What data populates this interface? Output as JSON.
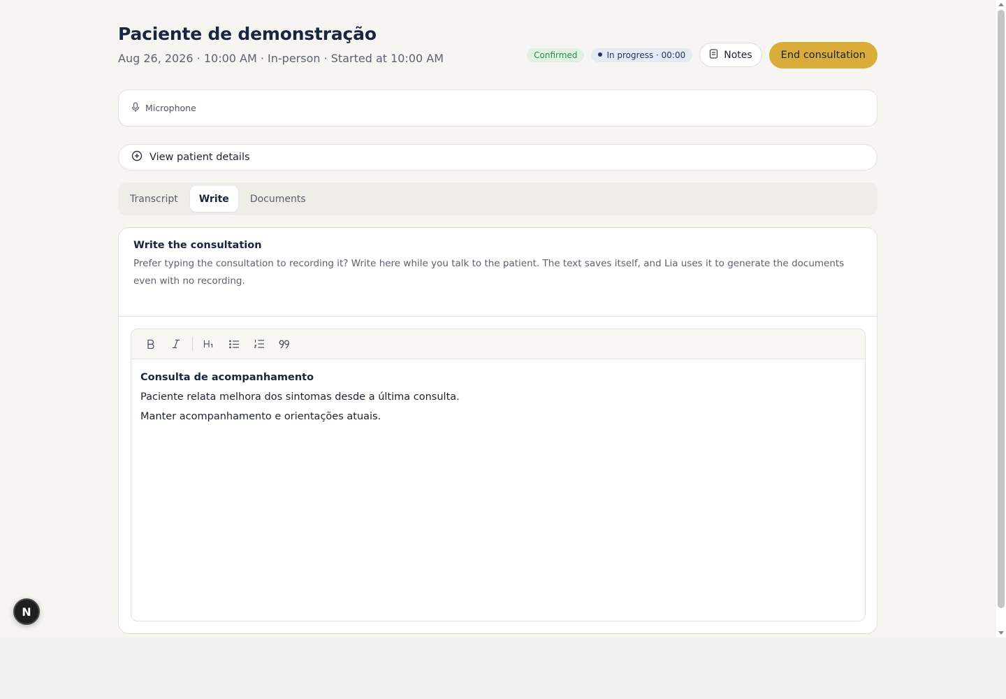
{
  "header": {
    "title": "Paciente de demonstração",
    "subtitle": "Aug 26, 2026 · 10:00 AM · In-person · Started at 10:00 AM",
    "status_badge": "Confirmed",
    "progress_badge": "In progress · 00:00",
    "notes_button": "Notes",
    "end_button": "End consultation",
    "colors": {
      "accent": "#d8ad3a",
      "confirmed": "#2e8a4b",
      "progress": "#253461"
    }
  },
  "microphone": {
    "label": "Microphone",
    "icon": "microphone-icon"
  },
  "patient_details": {
    "label": "View patient details",
    "icon": "heart-plus-icon"
  },
  "tabs": [
    {
      "label": "Transcript",
      "active": false
    },
    {
      "label": "Write",
      "active": true
    },
    {
      "label": "Documents",
      "active": false
    }
  ],
  "write": {
    "title": "Write the consultation",
    "description": "Prefer typing the consultation to recording it? Write here while you talk to the patient. The text saves itself, and Lia uses it to generate the documents even with no recording.",
    "toolbar": [
      "bold-icon",
      "italic-icon",
      "heading-1-icon",
      "bullet-list-icon",
      "numbered-list-icon",
      "quote-icon"
    ],
    "content": {
      "heading": "Consulta de acompanhamento",
      "line1": "Paciente relata melhora dos sintomas desde a última consulta.",
      "line2": "Manter acompanhamento e orientações atuais."
    }
  },
  "fab": {
    "label": "N"
  }
}
